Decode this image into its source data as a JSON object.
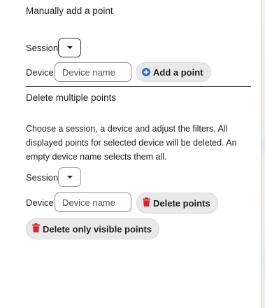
{
  "add_section": {
    "title": "Manually add a point",
    "session_label": "Session",
    "device_label": "Device",
    "device_placeholder": "Device name",
    "add_button_label": "Add a point"
  },
  "delete_section": {
    "title": "Delete multiple points",
    "description": "Choose a session, a device and adjust the filters. All displayed points for selected device will be deleted. An empty device name selects them all.",
    "session_label": "Session",
    "device_label": "Device",
    "device_placeholder": "Device name",
    "delete_points_label": "Delete points",
    "delete_visible_label": "Delete only visible points"
  },
  "colors": {
    "accent_blue": "#3f6fc4",
    "danger_red": "#d9232e",
    "button_bg": "#e9e9e9"
  }
}
